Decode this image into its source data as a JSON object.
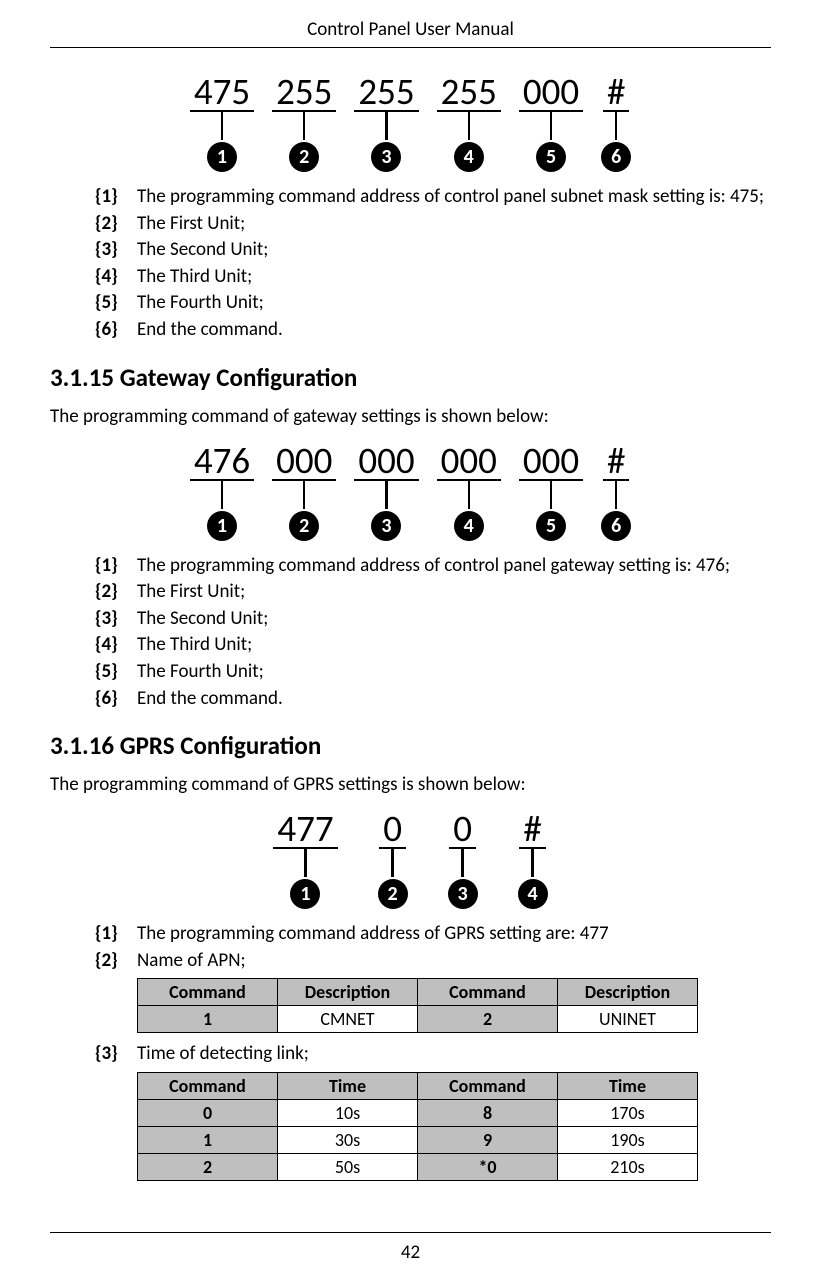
{
  "header": {
    "title": "Control Panel User Manual"
  },
  "footer": {
    "page": "42"
  },
  "diagram1": {
    "segments": [
      {
        "val": "475",
        "num": "1"
      },
      {
        "val": "255",
        "num": "2"
      },
      {
        "val": "255",
        "num": "3"
      },
      {
        "val": "255",
        "num": "4"
      },
      {
        "val": "000",
        "num": "5"
      },
      {
        "val": "#",
        "num": "6"
      }
    ],
    "items": [
      {
        "num": "{1}",
        "text": "The programming command address of control panel subnet mask setting is: 475;"
      },
      {
        "num": "{2}",
        "text": "The First Unit;"
      },
      {
        "num": "{3}",
        "text": "The Second Unit;"
      },
      {
        "num": "{4}",
        "text": "The Third Unit;"
      },
      {
        "num": "{5}",
        "text": "The Fourth Unit;"
      },
      {
        "num": "{6}",
        "text": "End the command."
      }
    ]
  },
  "section1": {
    "heading": "3.1.15 Gateway Configuration",
    "desc": "The programming command of gateway settings is shown below:"
  },
  "diagram2": {
    "segments": [
      {
        "val": "476",
        "num": "1"
      },
      {
        "val": "000",
        "num": "2"
      },
      {
        "val": "000",
        "num": "3"
      },
      {
        "val": "000",
        "num": "4"
      },
      {
        "val": "000",
        "num": "5"
      },
      {
        "val": "#",
        "num": "6"
      }
    ],
    "items": [
      {
        "num": "{1}",
        "text": "The programming command address of control panel gateway setting is: 476;"
      },
      {
        "num": "{2}",
        "text": "The First Unit;"
      },
      {
        "num": "{3}",
        "text": "The Second Unit;"
      },
      {
        "num": "{4}",
        "text": "The Third Unit;"
      },
      {
        "num": "{5}",
        "text": "The Fourth Unit;"
      },
      {
        "num": "{6}",
        "text": "End the command."
      }
    ]
  },
  "section2": {
    "heading": "3.1.16 GPRS Configuration",
    "desc": "The programming command of GPRS settings is shown below:"
  },
  "diagram3": {
    "segments": [
      {
        "val": "477",
        "num": "1"
      },
      {
        "val": "0",
        "num": "2"
      },
      {
        "val": "0",
        "num": "3"
      },
      {
        "val": "#",
        "num": "4"
      }
    ],
    "items": [
      {
        "num": "{1}",
        "text": "The programming command address of GPRS setting are: 477"
      },
      {
        "num": "{2}",
        "text": "Name of APN;"
      },
      {
        "num": "{3}",
        "text": "Time of detecting link;"
      }
    ]
  },
  "table1": {
    "headers": [
      "Command",
      "Description",
      "Command",
      "Description"
    ],
    "rows": [
      [
        "1",
        "CMNET",
        "2",
        "UNINET"
      ]
    ]
  },
  "table2": {
    "headers": [
      "Command",
      "Time",
      "Command",
      "Time"
    ],
    "rows": [
      [
        "0",
        "10s",
        "8",
        "170s"
      ],
      [
        "1",
        "30s",
        "9",
        "190s"
      ],
      [
        "2",
        "50s",
        "*0",
        "210s"
      ]
    ]
  }
}
